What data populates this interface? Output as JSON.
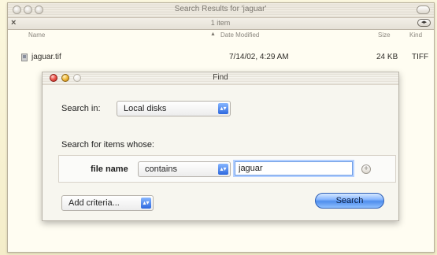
{
  "results_window": {
    "title": "Search Results for 'jaguar'",
    "status_count": "1 item",
    "columns": {
      "name": "Name",
      "date_modified": "Date Modified",
      "size": "Size",
      "kind": "Kind"
    },
    "rows": [
      {
        "name": "jaguar.tif",
        "date_modified": "7/14/02, 4:29 AM",
        "size": "24 KB",
        "kind": "TIFF"
      }
    ]
  },
  "find_window": {
    "title": "Find",
    "search_in_label": "Search in:",
    "search_in_value": "Local disks",
    "search_for_label": "Search for items whose:",
    "criterion_label": "file name",
    "criterion_operator": "contains",
    "criterion_value": "jaguar",
    "add_criteria_label": "Add criteria...",
    "search_button_label": "Search"
  }
}
